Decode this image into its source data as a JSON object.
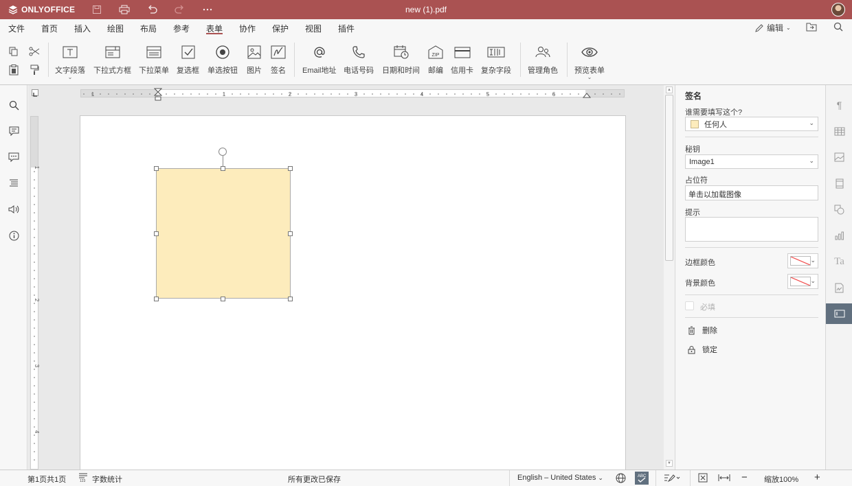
{
  "app": {
    "logo_text": "ONLYOFFICE",
    "document_title": "new (1).pdf"
  },
  "colors": {
    "brand": "#aa5252",
    "field_fill": "#fdecbc",
    "active_sidebar": "#61707f"
  },
  "menu": {
    "tabs": [
      {
        "label": "文件"
      },
      {
        "label": "首页"
      },
      {
        "label": "插入"
      },
      {
        "label": "绘图"
      },
      {
        "label": "布局"
      },
      {
        "label": "参考"
      },
      {
        "label": "表单"
      },
      {
        "label": "协作"
      },
      {
        "label": "保护"
      },
      {
        "label": "视图"
      },
      {
        "label": "插件"
      }
    ],
    "active_tab": "表单",
    "edit_mode_label": "编辑"
  },
  "toolbar": {
    "items": [
      {
        "label": "文字段落",
        "icon": "text-field-icon"
      },
      {
        "label": "下拉式方框",
        "icon": "combo-box-icon"
      },
      {
        "label": "下拉菜单",
        "icon": "dropdown-list-icon"
      },
      {
        "label": "复选框",
        "icon": "checkbox-icon"
      },
      {
        "label": "单选按钮",
        "icon": "radio-button-icon"
      },
      {
        "label": "图片",
        "icon": "image-icon"
      },
      {
        "label": "签名",
        "icon": "signature-icon"
      },
      {
        "label": "Email地址",
        "icon": "at-icon"
      },
      {
        "label": "电话号码",
        "icon": "phone-icon"
      },
      {
        "label": "日期和时间",
        "icon": "calendar-clock-icon"
      },
      {
        "label": "邮编",
        "icon": "zip-icon"
      },
      {
        "label": "信用卡",
        "icon": "credit-card-icon"
      },
      {
        "label": "复杂字段",
        "icon": "complex-field-icon"
      },
      {
        "label": "管理角色",
        "icon": "manage-roles-icon"
      },
      {
        "label": "预览表单",
        "icon": "eye-icon"
      }
    ]
  },
  "ruler": {
    "h_marks": [
      "1",
      "1",
      "2",
      "3",
      "4",
      "5",
      "6"
    ],
    "v_marks": [
      "1",
      "2",
      "3",
      "4"
    ]
  },
  "panel": {
    "title": "签名",
    "who_fills_label": "谁需要填写这个?",
    "who_fills_value": "任何人",
    "key_label": "秘钥",
    "key_value": "Image1",
    "placeholder_label": "占位符",
    "placeholder_value": "单击以加载图像",
    "tip_label": "提示",
    "tip_value": "",
    "border_color_label": "边框颜色",
    "background_color_label": "背景颜色",
    "required_label": "必填",
    "delete_label": "删除",
    "lock_label": "锁定"
  },
  "status": {
    "page_info": "第1页共1页",
    "word_count": "字数统计",
    "save_status": "所有更改已保存",
    "language": "English – United States",
    "zoom": "缩放100%"
  }
}
